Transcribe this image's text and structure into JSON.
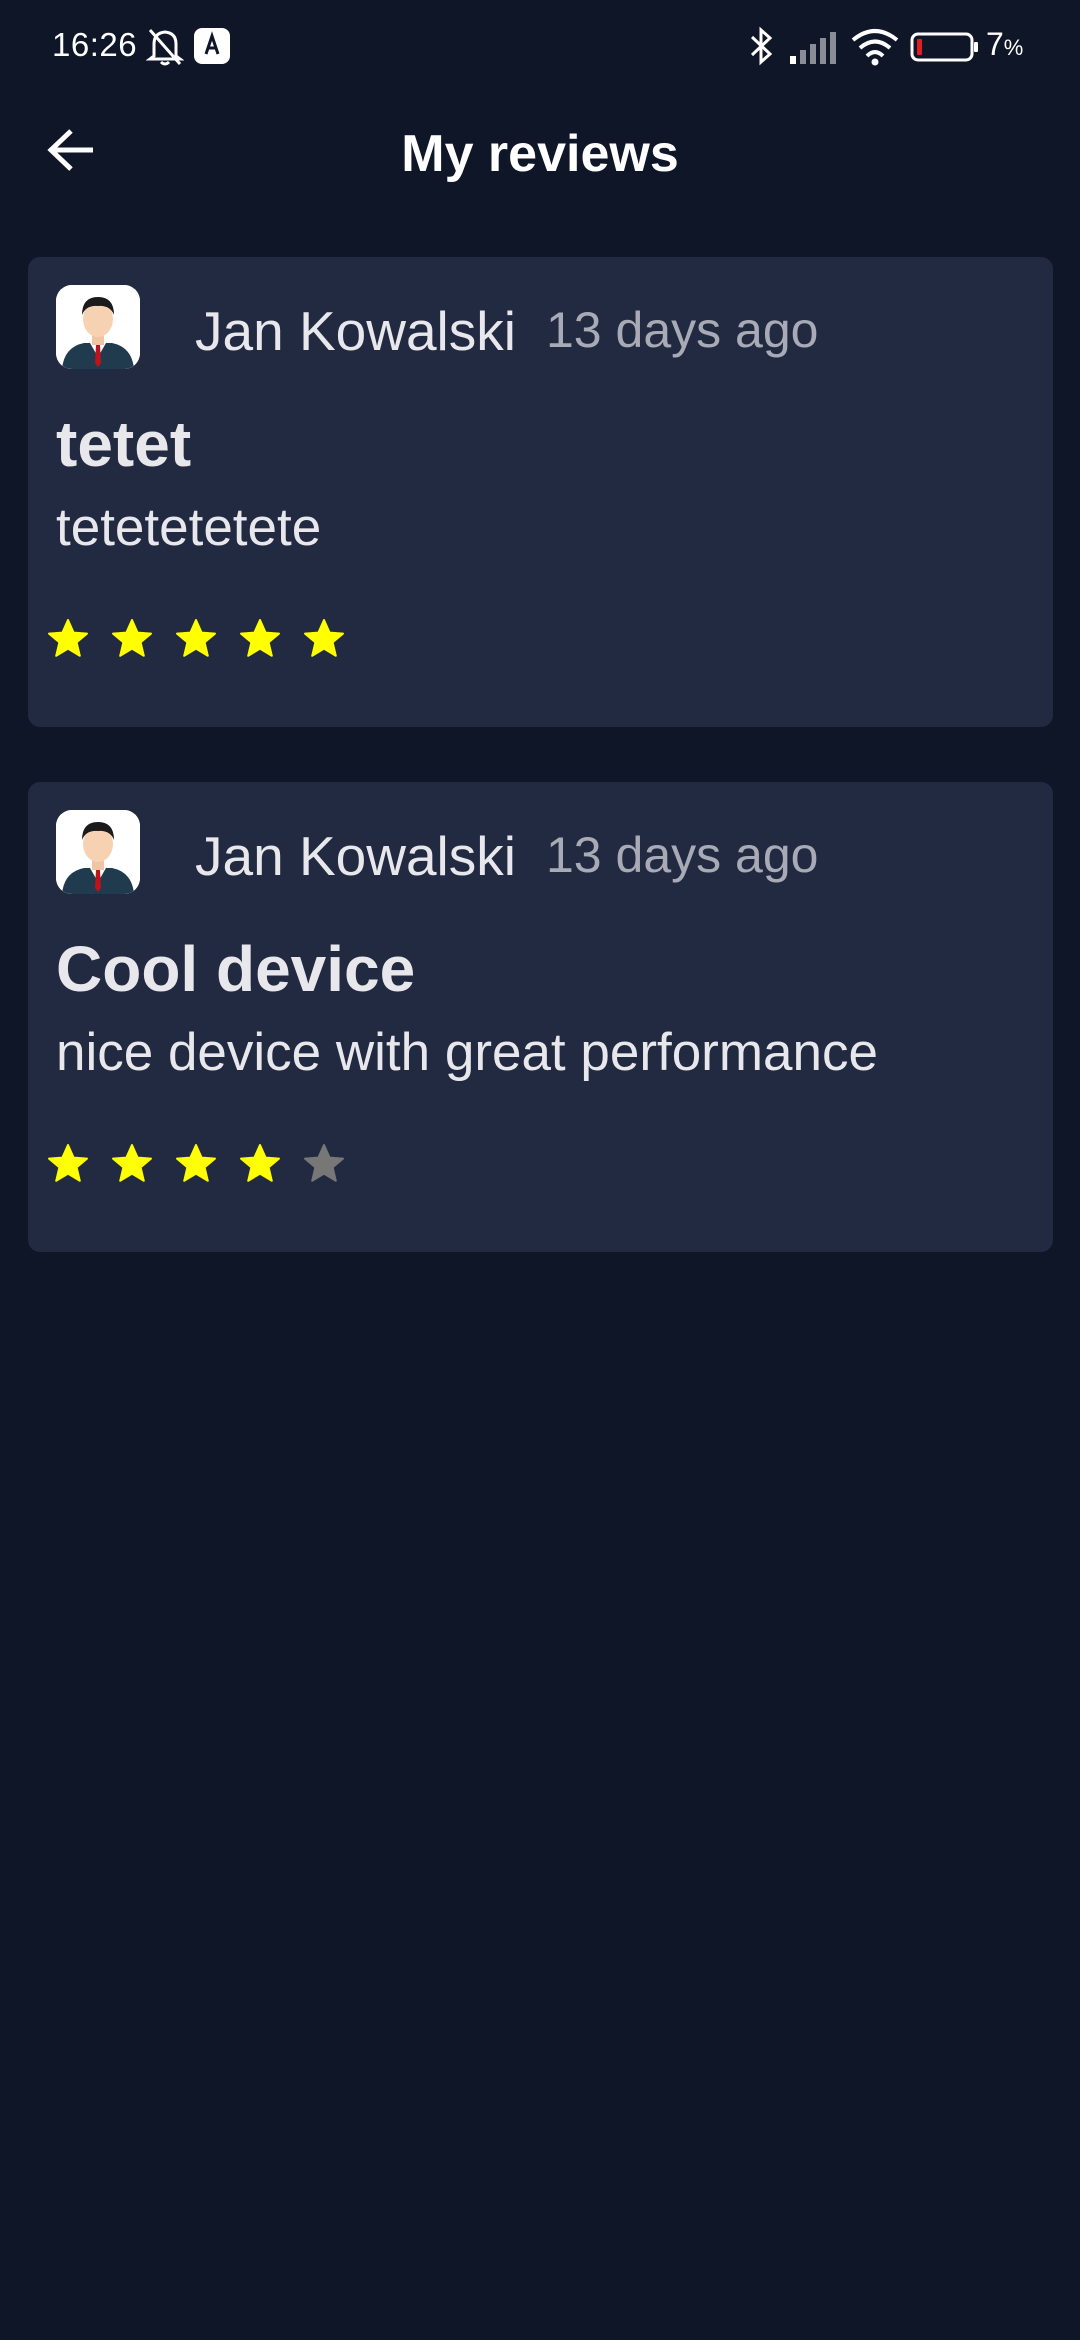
{
  "status_bar": {
    "time": "16:26",
    "battery_percent": "7",
    "battery_unit": "%",
    "icons": [
      "bell-off-icon",
      "app-notification-icon",
      "bluetooth-icon",
      "signal-icon",
      "wifi-icon",
      "battery-icon"
    ]
  },
  "app_bar": {
    "title": "My reviews",
    "back_icon": "arrow-left-icon"
  },
  "colors": {
    "background": "#0f1628",
    "card": "#222a42",
    "star_filled": "#ffff00",
    "star_empty": "#777777"
  },
  "reviews": [
    {
      "author": "Jan Kowalski",
      "date": "13 days ago",
      "title": "tetet",
      "body": "tetetetetete",
      "rating": 5,
      "max_rating": 5
    },
    {
      "author": "Jan Kowalski",
      "date": "13 days ago",
      "title": "Cool device",
      "body": "nice device with great performance",
      "rating": 4,
      "max_rating": 5
    }
  ]
}
